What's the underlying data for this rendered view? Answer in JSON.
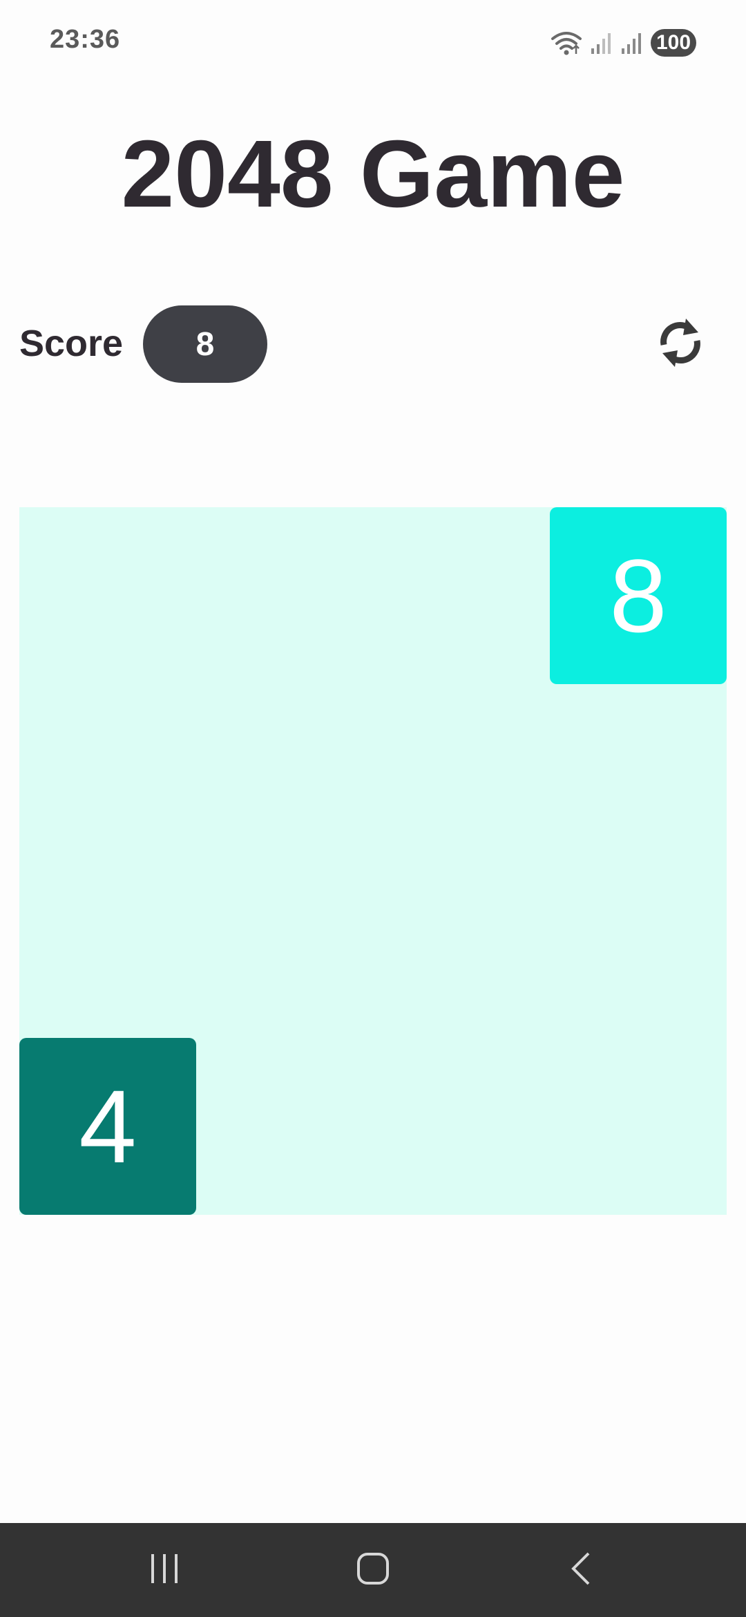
{
  "status_bar": {
    "time": "23:36",
    "battery": "100",
    "icons": [
      "wifi-icon",
      "signal-icon",
      "signal-icon"
    ]
  },
  "header": {
    "title": "2048 Game"
  },
  "score": {
    "label": "Score",
    "value": "8"
  },
  "restart": {
    "icon": "refresh-icon"
  },
  "board": {
    "rows": 4,
    "cols": 4,
    "background": "#dcfdf5",
    "tiles": [
      {
        "value": "8",
        "row": 1,
        "col": 4,
        "color": "#0ceee0"
      },
      {
        "value": "4",
        "row": 4,
        "col": 1,
        "color": "#077b70"
      }
    ]
  },
  "nav_bar": {
    "buttons": [
      "recents-icon",
      "home-icon",
      "back-icon"
    ]
  }
}
